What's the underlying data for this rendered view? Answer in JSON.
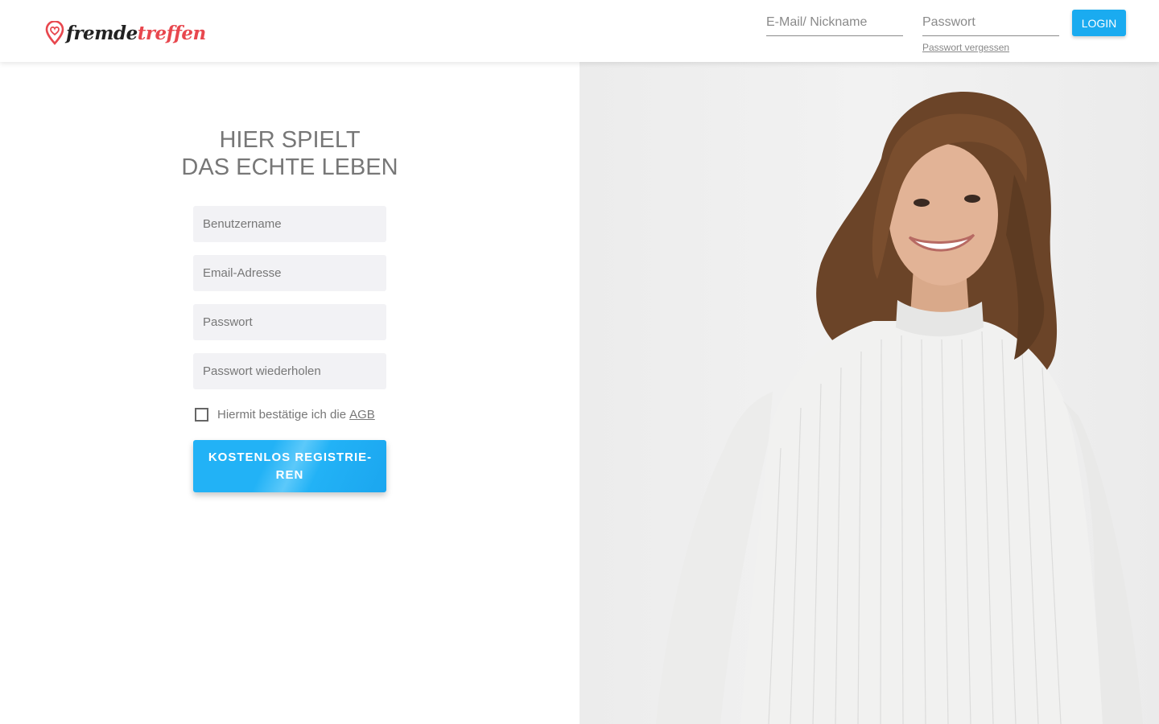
{
  "brand": {
    "name_dark": "fremde",
    "name_red": "treffen",
    "accent": "#e8474e",
    "primary": "#1aabf0"
  },
  "header": {
    "email_placeholder": "E-Mail/ Nickname",
    "password_placeholder": "Passwort",
    "forgot_label": "Passwort vergessen",
    "login_label": "LOGIN"
  },
  "main": {
    "headline_line1": "HIER SPIELT",
    "headline_line2": "DAS ECHTE LEBEN",
    "form": {
      "username_placeholder": "Benutzername",
      "email_placeholder": "Email-Adresse",
      "password_placeholder": "Passwort",
      "password_repeat_placeholder": "Passwort wiederholen",
      "agb_text": "Hiermit bestätige ich die",
      "agb_link": "AGB",
      "agb_checked": false,
      "register_label": "KOSTENLOS REGISTRIE­REN"
    }
  },
  "hero": {
    "alt_icon": "smiling-woman-photo"
  }
}
